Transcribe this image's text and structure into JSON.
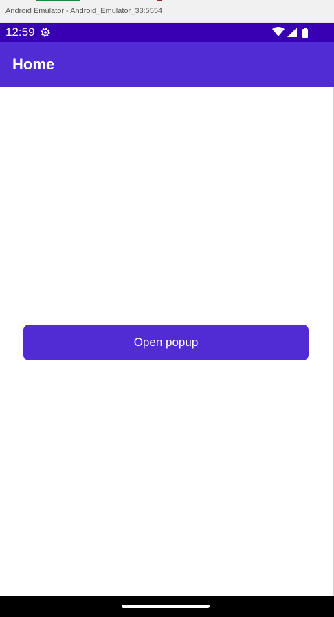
{
  "window": {
    "title": "Android Emulator - Android_Emulator_33:5554"
  },
  "status_bar": {
    "time": "12:59",
    "icons": [
      "settings-icon",
      "wifi-icon",
      "signal-icon",
      "battery-icon"
    ]
  },
  "app_bar": {
    "title": "Home"
  },
  "main": {
    "open_popup_label": "Open popup"
  },
  "colors": {
    "status_bar": "#3700b3",
    "primary": "#512bd4",
    "nav_bar": "#000000",
    "background": "#ffffff"
  }
}
